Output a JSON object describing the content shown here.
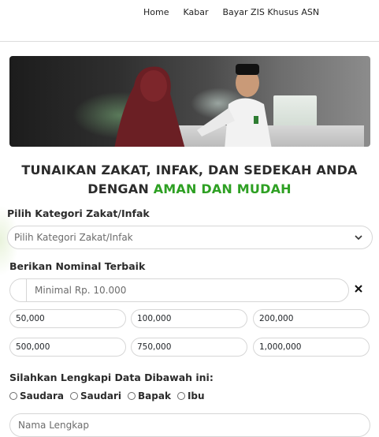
{
  "nav": {
    "items": [
      "Home",
      "Kabar",
      "Bayar ZIS Khusus ASN"
    ]
  },
  "hero": {
    "icon": "service-desk-photo"
  },
  "heading": {
    "line1": "TUNAIKAN ZAKAT, INFAK, DAN SEDEKAH ANDA",
    "line2_prefix": "DENGAN",
    "line2_highlight": "AMAN DAN MUDAH",
    "highlight_color": "#2ea023"
  },
  "category": {
    "label": "Pilih Kategori Zakat/Infak",
    "placeholder": "Pilih Kategori Zakat/Infak",
    "icon": "chevron-down-icon"
  },
  "nominal": {
    "label": "Berikan Nominal Terbaik",
    "placeholder": "Minimal Rp. 10.000",
    "clear_icon": "close-icon",
    "presets": [
      "50,000",
      "100,000",
      "200,000",
      "500,000",
      "750,000",
      "1,000,000"
    ]
  },
  "data_form": {
    "label": "Silahkan Lengkapi Data Dibawah ini:",
    "salutations": [
      "Saudara",
      "Saudari",
      "Bapak",
      "Ibu"
    ],
    "name_placeholder": "Nama Lengkap"
  }
}
